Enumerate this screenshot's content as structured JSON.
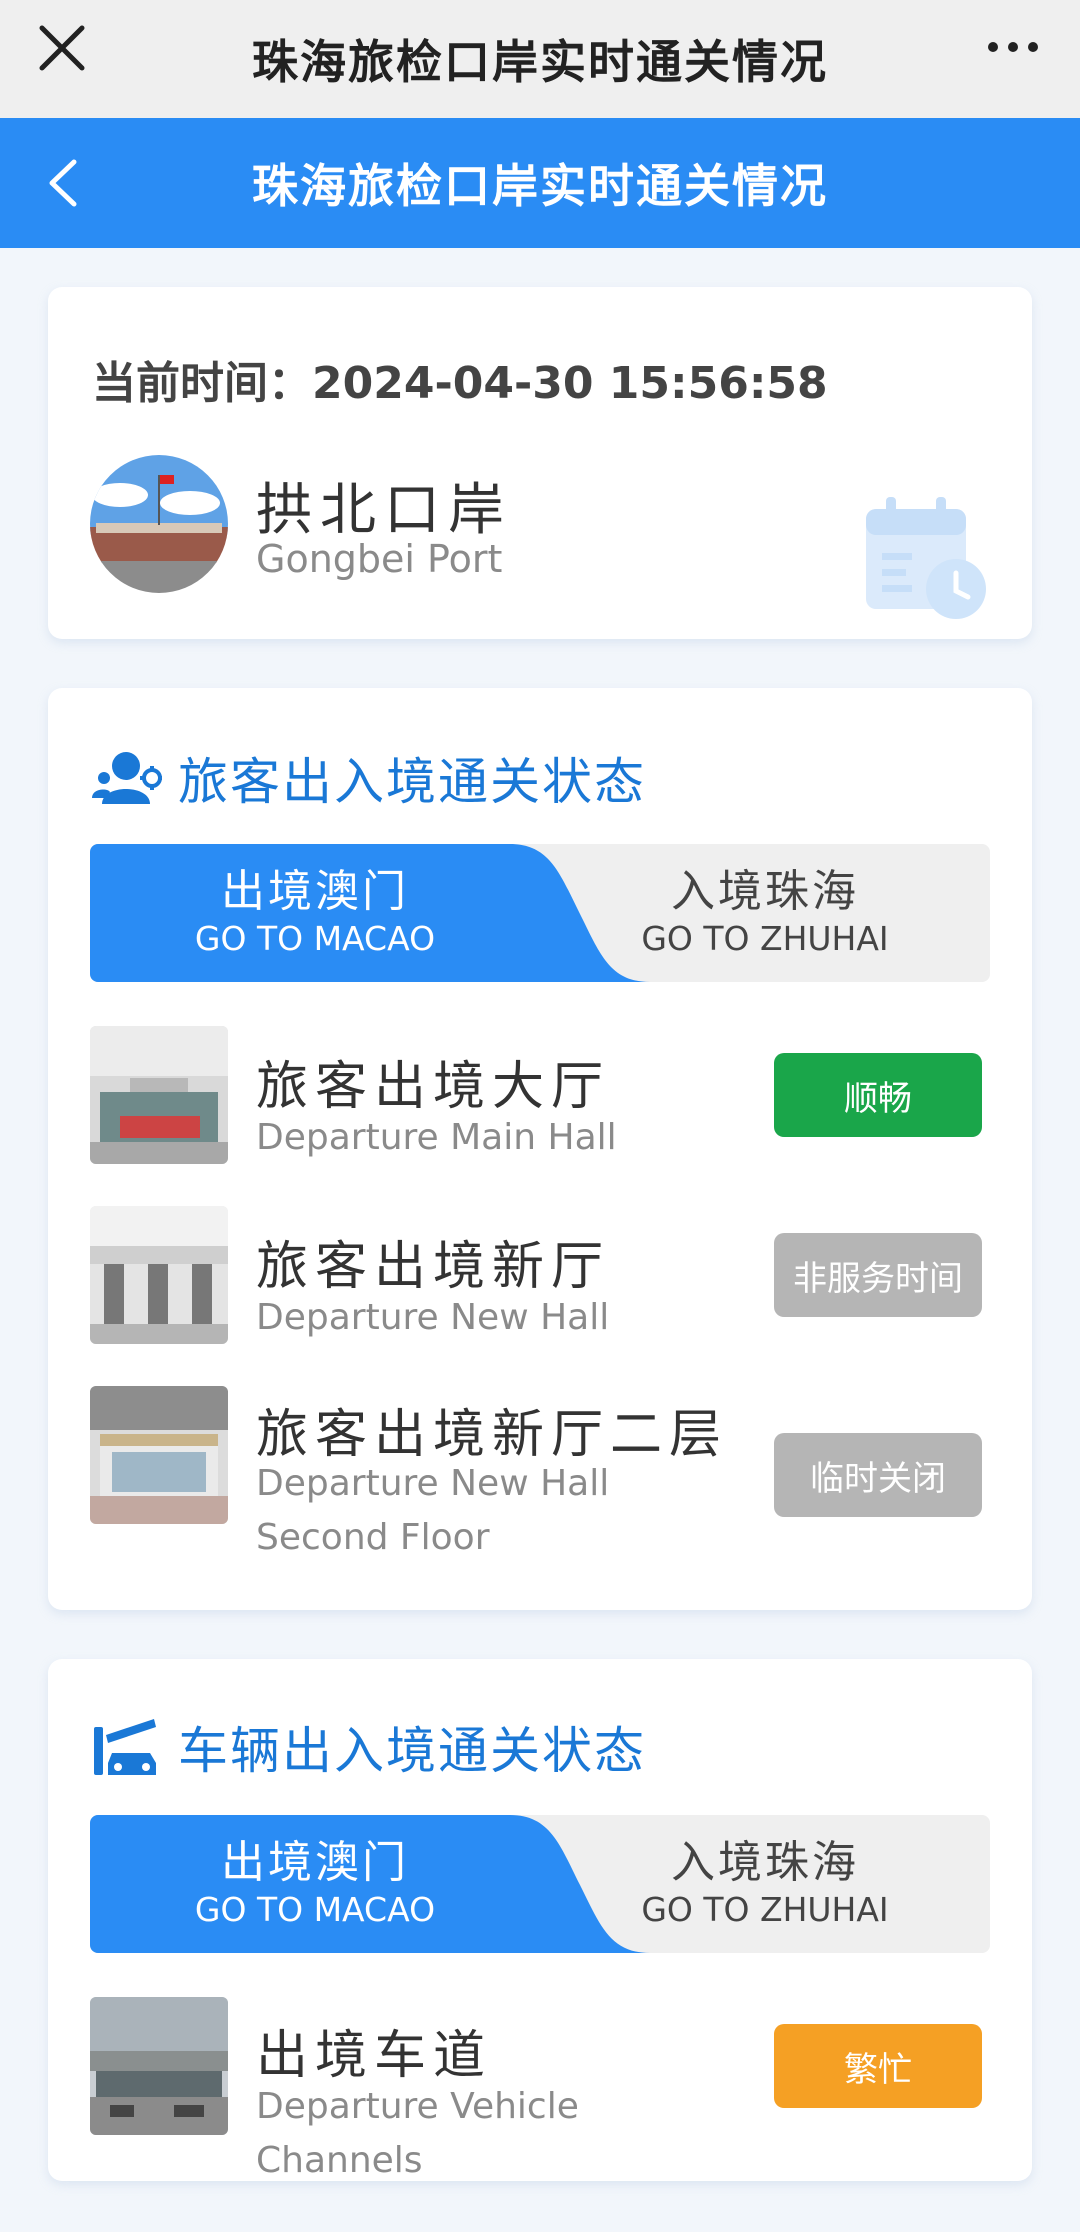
{
  "window": {
    "title": "珠海旅检口岸实时通关情况"
  },
  "nav": {
    "title": "珠海旅检口岸实时通关情况"
  },
  "info": {
    "time_label": "当前时间：",
    "time_value": "2024-04-30 15:56:58",
    "port_cn": "拱北口岸",
    "port_en": "Gongbei Port"
  },
  "passenger": {
    "title": "旅客出入境通关状态",
    "tabs": [
      {
        "cn": "出境澳门",
        "en": "GO TO MACAO",
        "active": true
      },
      {
        "cn": "入境珠海",
        "en": "GO TO ZHUHAI",
        "active": false
      }
    ],
    "rows": [
      {
        "cn": "旅客出境大厅",
        "en": "Departure Main Hall",
        "status": "顺畅",
        "status_color": "#1aa64a"
      },
      {
        "cn": "旅客出境新厅",
        "en": "Departure New Hall",
        "status": "非服务时间",
        "status_color": "#b5b5b5"
      },
      {
        "cn": "旅客出境新厅二层",
        "en": "Departure New Hall Second Floor",
        "status": "临时关闭",
        "status_color": "#b5b5b5"
      }
    ]
  },
  "vehicle": {
    "title": "车辆出入境通关状态",
    "tabs": [
      {
        "cn": "出境澳门",
        "en": "GO TO MACAO",
        "active": true
      },
      {
        "cn": "入境珠海",
        "en": "GO TO ZHUHAI",
        "active": false
      }
    ],
    "rows": [
      {
        "cn": "出境车道",
        "en": "Departure Vehicle Channels",
        "status": "繁忙",
        "status_color": "#f5a024"
      }
    ]
  },
  "colors": {
    "accent": "#2a8cf4",
    "heading": "#1a78d6"
  }
}
